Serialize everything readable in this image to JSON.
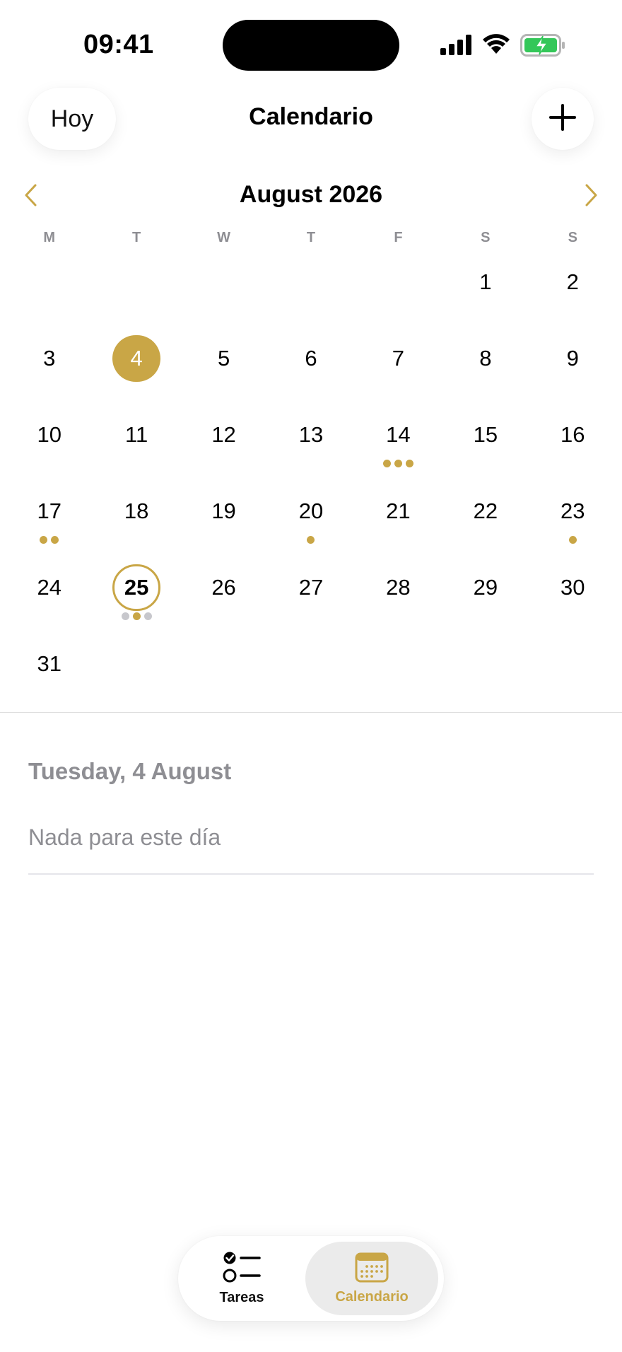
{
  "status_bar": {
    "time": "09:41",
    "icons": [
      "cellular-signal-icon",
      "wifi-icon",
      "battery-charging-icon"
    ]
  },
  "header": {
    "today_button": "Hoy",
    "title": "Calendario",
    "add_icon": "plus-icon"
  },
  "calendar": {
    "month_title": "August 2026",
    "prev_icon": "chevron-left-icon",
    "next_icon": "chevron-right-icon",
    "weekdays": [
      "M",
      "T",
      "W",
      "T",
      "F",
      "S",
      "S"
    ],
    "leading_blanks": 5,
    "days_in_month": 31,
    "selected_day": 4,
    "today_day": 25,
    "event_dots": {
      "14": [
        "gold",
        "gold",
        "gold"
      ],
      "17": [
        "gold",
        "gold"
      ],
      "20": [
        "gold"
      ],
      "23": [
        "gold"
      ],
      "25": [
        "grey",
        "gold",
        "grey"
      ]
    }
  },
  "day_detail": {
    "date_label": "Tuesday, 4 August",
    "empty_message": "Nada para este día"
  },
  "tab_bar": {
    "tabs": [
      {
        "label": "Tareas",
        "icon": "task-list-icon",
        "active": false
      },
      {
        "label": "Calendario",
        "icon": "calendar-icon",
        "active": true
      }
    ]
  },
  "colors": {
    "accent": "#c9a646",
    "secondary_text": "#8e8e93",
    "dot_grey": "#c7c7cc",
    "battery_green": "#34c759"
  }
}
